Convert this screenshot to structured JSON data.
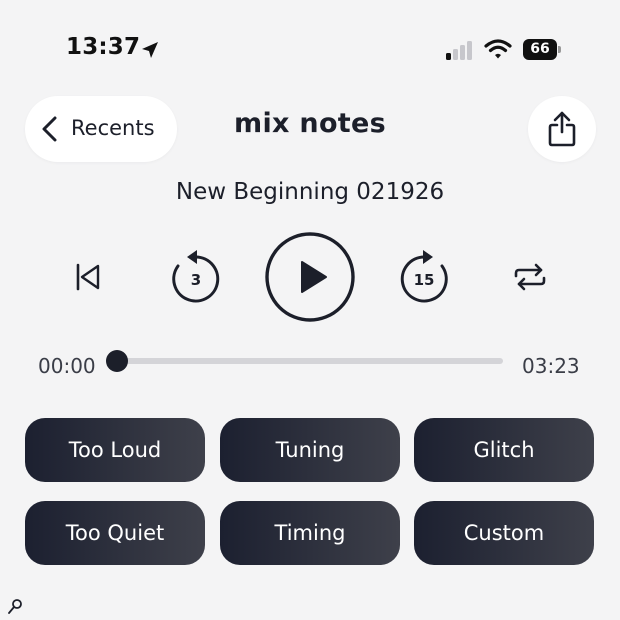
{
  "status_bar": {
    "time": "13:37",
    "battery": "66"
  },
  "header": {
    "back_label": "Recents",
    "title": "mix notes"
  },
  "player": {
    "track_title": "New Beginning 021926",
    "skip_back_seconds": "3",
    "skip_forward_seconds": "15",
    "elapsed": "00:00",
    "remaining": "03:23",
    "progress": 0
  },
  "note_buttons": [
    {
      "label": "Too Loud"
    },
    {
      "label": "Tuning"
    },
    {
      "label": "Glitch"
    },
    {
      "label": "Too Quiet"
    },
    {
      "label": "Timing"
    },
    {
      "label": "Custom"
    }
  ],
  "colors": {
    "background": "#f4f4f5",
    "accent_dark": "#1c1f2a",
    "track": "#d4d4d8"
  },
  "icons": [
    "location-arrow-icon",
    "signal-icon",
    "wifi-icon",
    "battery-icon",
    "chevron-left-icon",
    "share-icon",
    "skip-to-start-icon",
    "rewind-icon",
    "play-icon",
    "forward-icon",
    "repeat-icon",
    "search-key-icon"
  ]
}
